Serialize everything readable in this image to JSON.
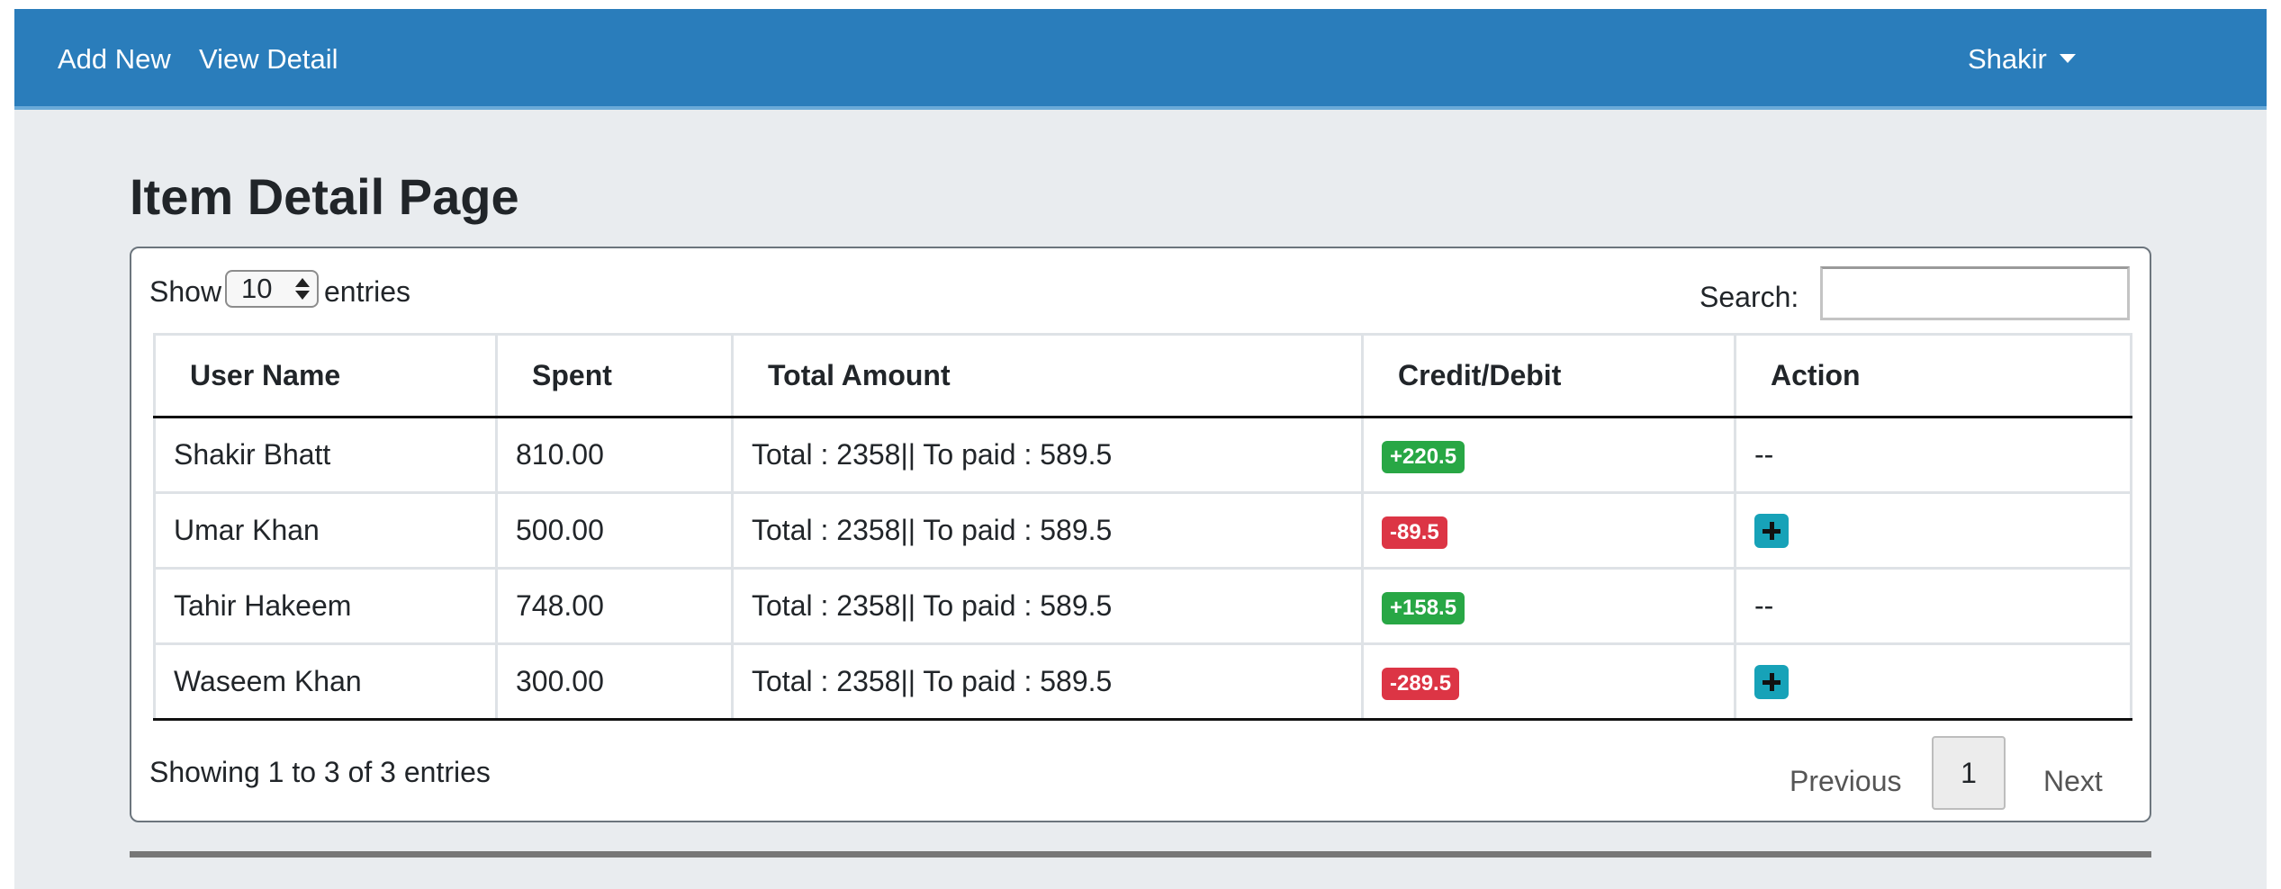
{
  "navbar": {
    "add_new": "Add New",
    "view_detail": "View Detail",
    "user": "Shakir"
  },
  "page": {
    "title": "Item Detail Page"
  },
  "controls": {
    "show_label": "Show",
    "entries_value": "10",
    "entries_label": "entries",
    "search_label": "Search:",
    "search_value": ""
  },
  "table": {
    "headers": [
      "User Name",
      "Spent",
      "Total Amount",
      "Credit/Debit",
      "Action"
    ],
    "rows": [
      {
        "user": "Shakir Bhatt",
        "spent": "810.00",
        "total": "Total : 2358|| To paid : 589.5",
        "credit": "+220.5",
        "credit_type": "success",
        "action": "--"
      },
      {
        "user": "Umar Khan",
        "spent": "500.00",
        "total": "Total : 2358|| To paid : 589.5",
        "credit": "-89.5",
        "credit_type": "danger",
        "action": "add"
      },
      {
        "user": "Tahir Hakeem",
        "spent": "748.00",
        "total": "Total : 2358|| To paid : 589.5",
        "credit": "+158.5",
        "credit_type": "success",
        "action": "--"
      },
      {
        "user": "Waseem Khan",
        "spent": "300.00",
        "total": "Total : 2358|| To paid : 589.5",
        "credit": "-289.5",
        "credit_type": "danger",
        "action": "add"
      }
    ]
  },
  "footer": {
    "info": "Showing 1 to 3 of 3 entries",
    "previous": "Previous",
    "current_page": "1",
    "next": "Next"
  },
  "colors": {
    "navbar": "#2a7dbb",
    "success": "#28a745",
    "danger": "#dc3545",
    "info": "#17a2b8"
  }
}
